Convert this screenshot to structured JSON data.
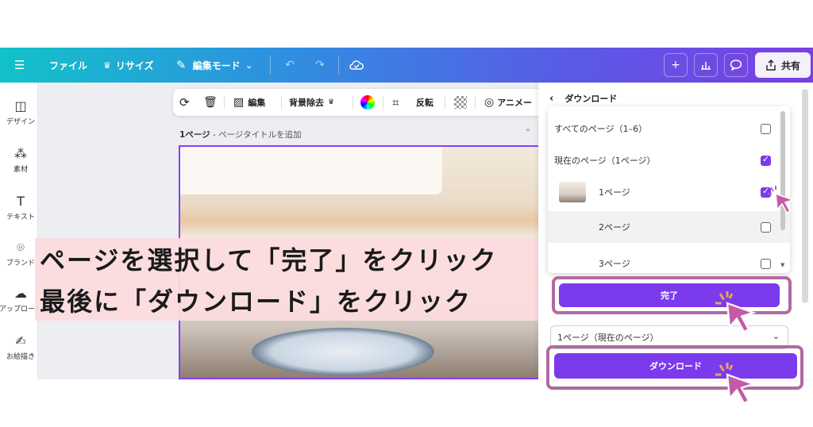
{
  "topbar": {
    "menu_icon": "hamburger-icon",
    "file_label": "ファイル",
    "resize_label": "リサイズ",
    "edit_mode_label": "編集モード",
    "share_label": "共有"
  },
  "sidebar": {
    "items": [
      {
        "label": "デザイン",
        "icon": "design-icon"
      },
      {
        "label": "素材",
        "icon": "elements-icon"
      },
      {
        "label": "テキスト",
        "icon": "text-icon"
      },
      {
        "label": "ブランド",
        "icon": "brand-icon"
      },
      {
        "label": "アップロード",
        "icon": "upload-icon"
      },
      {
        "label": "お絵描き",
        "icon": "draw-icon"
      }
    ]
  },
  "toolbar2": {
    "edit_label": "編集",
    "bg_remove_label": "背景除去",
    "flip_label": "反転",
    "animate_label": "アニメー"
  },
  "canvas": {
    "page_label_bold": "1ページ",
    "page_label_rest": " - ページタイトルを追加"
  },
  "caption": {
    "line1": "ページを選択して「完了」をクリック",
    "line2": "最後に「ダウンロード」をクリック"
  },
  "download_panel": {
    "title": "ダウンロード",
    "rows": [
      {
        "label": "すべてのページ（1–6）",
        "checked": false
      },
      {
        "label": "現在のページ（1ページ）",
        "checked": true
      },
      {
        "label": "1ページ",
        "checked": true
      },
      {
        "label": "2ページ",
        "checked": false
      },
      {
        "label": "3ページ",
        "checked": false
      }
    ],
    "done_label": "完了",
    "select_value": "1ページ（現在のページ）",
    "download_label": "ダウンロード"
  },
  "colors": {
    "accent": "#7c3aed",
    "highlight_border": "#b06aa1",
    "caption_bg": "#fcdcde"
  }
}
